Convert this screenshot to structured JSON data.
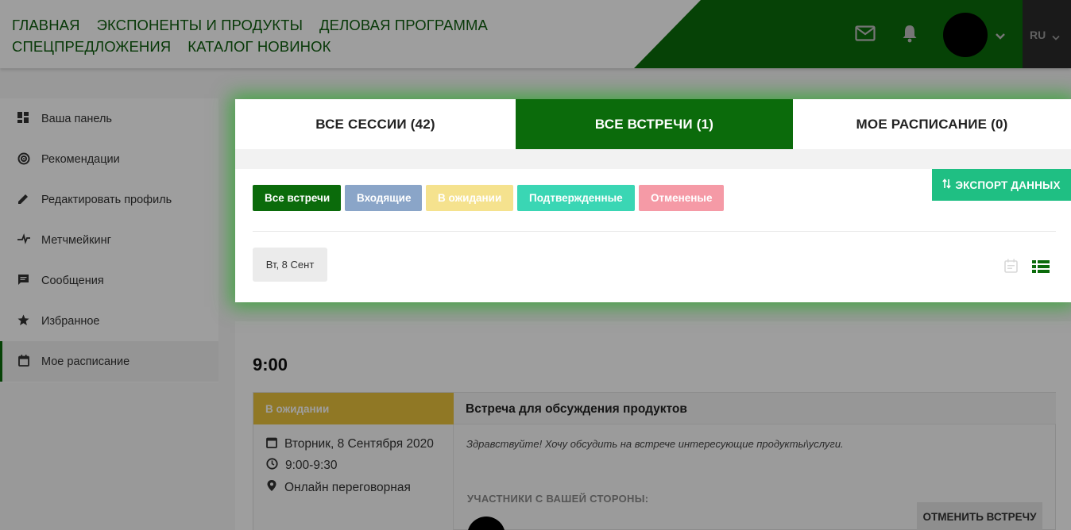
{
  "header": {
    "nav_row1": [
      "ГЛАВНАЯ",
      "ЭКСПОНЕНТЫ И ПРОДУКТЫ",
      "ДЕЛОВАЯ ПРОГРАММА"
    ],
    "nav_row2": [
      "СПЕЦПРЕДЛОЖЕНИЯ",
      "КАТАЛОГ НОВИНОК"
    ],
    "lang": "RU",
    "icons": [
      "mail-icon",
      "bell-icon",
      "chevron-down-icon"
    ]
  },
  "sidebar": {
    "items": [
      {
        "label": "Ваша панель",
        "icon": "dashboard-icon"
      },
      {
        "label": "Рекомендации",
        "icon": "target-icon"
      },
      {
        "label": "Редактировать профиль",
        "icon": "pencil-icon"
      },
      {
        "label": "Метчмейкинг",
        "icon": "matchmaking-icon"
      },
      {
        "label": "Сообщения",
        "icon": "message-icon"
      },
      {
        "label": "Избранное",
        "icon": "star-icon"
      },
      {
        "label": "Мое расписание",
        "icon": "calendar-icon"
      }
    ]
  },
  "tabs": [
    {
      "label": "ВСЕ СЕССИИ (42)"
    },
    {
      "label": "ВСЕ ВСТРЕЧИ (1)"
    },
    {
      "label": "МОЕ РАСПИСАНИЕ (0)"
    }
  ],
  "filters": [
    "Все встречи",
    "Входящие",
    "В ожидании",
    "Подтвержденные",
    "Отмененые"
  ],
  "export_label": "ЭКСПОРТ ДАННЫХ",
  "date_chip": "Вт, 8 Сент",
  "schedule": {
    "time": "9:00",
    "status": "В ожидании",
    "date_text": "Вторник, 8 Сентября 2020",
    "time_range": "9:00-9:30",
    "location": "Онлайн переговорная",
    "title": "Встреча для обсуждения продуктов",
    "message": "Здравствуйте! Хочу обсудить на встрече интересующие продукты\\услуги.",
    "participants_label": "УЧАСТНИКИ С ВАШЕЙ СТОРОНЫ:",
    "cancel_label": "ОТМЕНИТЬ ВСТРЕЧУ"
  },
  "colors": {
    "brand_green": "#0b6b0b",
    "export_teal": "#1fbf83",
    "pending_yellow": "#e8c23c"
  }
}
